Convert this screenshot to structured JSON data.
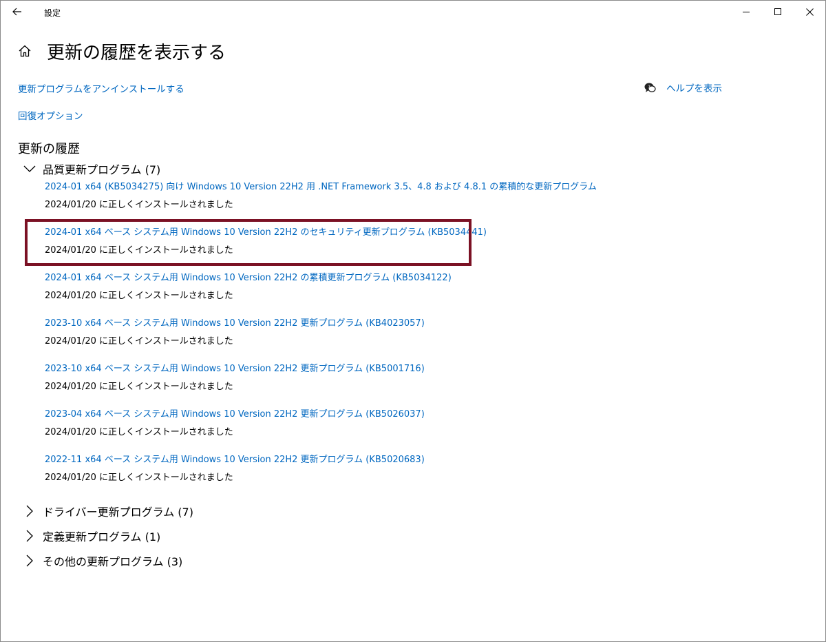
{
  "window": {
    "app_title": "設定",
    "back_icon": "arrow-left-icon",
    "minimize_icon": "minimize-icon",
    "maximize_icon": "maximize-icon",
    "close_icon": "close-icon"
  },
  "header": {
    "home_icon": "home-icon",
    "title": "更新の履歴を表示する"
  },
  "links": {
    "uninstall": "更新プログラムをアンインストールする",
    "recovery": "回復オプション",
    "help_icon": "chat-help-icon",
    "help": "ヘルプを表示"
  },
  "history": {
    "heading": "更新の履歴",
    "groups": [
      {
        "label": "品質更新プログラム (7)",
        "expanded": true,
        "items": [
          {
            "title": "2024-01 x64 (KB5034275) 向け Windows 10 Version 22H2 用 .NET Framework 3.5、4.8 および 4.8.1 の累積的な更新プログラム",
            "status": "2024/01/20 に正しくインストールされました"
          },
          {
            "title": "2024-01 x64 ベース システム用 Windows 10 Version 22H2 のセキュリティ更新プログラム (KB5034441)",
            "status": "2024/01/20 に正しくインストールされました",
            "highlighted": true
          },
          {
            "title": "2024-01 x64 ベース システム用 Windows 10 Version 22H2 の累積更新プログラム (KB5034122)",
            "status": "2024/01/20 に正しくインストールされました"
          },
          {
            "title": "2023-10 x64 ベース システム用 Windows 10 Version 22H2 更新プログラム (KB4023057)",
            "status": "2024/01/20 に正しくインストールされました"
          },
          {
            "title": "2023-10 x64 ベース システム用 Windows 10 Version 22H2 更新プログラム (KB5001716)",
            "status": "2024/01/20 に正しくインストールされました"
          },
          {
            "title": "2023-04 x64 ベース システム用 Windows 10 Version 22H2 更新プログラム (KB5026037)",
            "status": "2024/01/20 に正しくインストールされました"
          },
          {
            "title": "2022-11 x64 ベース システム用 Windows 10 Version 22H2 更新プログラム (KB5020683)",
            "status": "2024/01/20 に正しくインストールされました"
          }
        ]
      },
      {
        "label": "ドライバー更新プログラム (7)",
        "expanded": false
      },
      {
        "label": "定義更新プログラム (1)",
        "expanded": false
      },
      {
        "label": "その他の更新プログラム (3)",
        "expanded": false
      }
    ]
  },
  "colors": {
    "link": "#0067c0",
    "highlight_border": "#7b1124"
  }
}
